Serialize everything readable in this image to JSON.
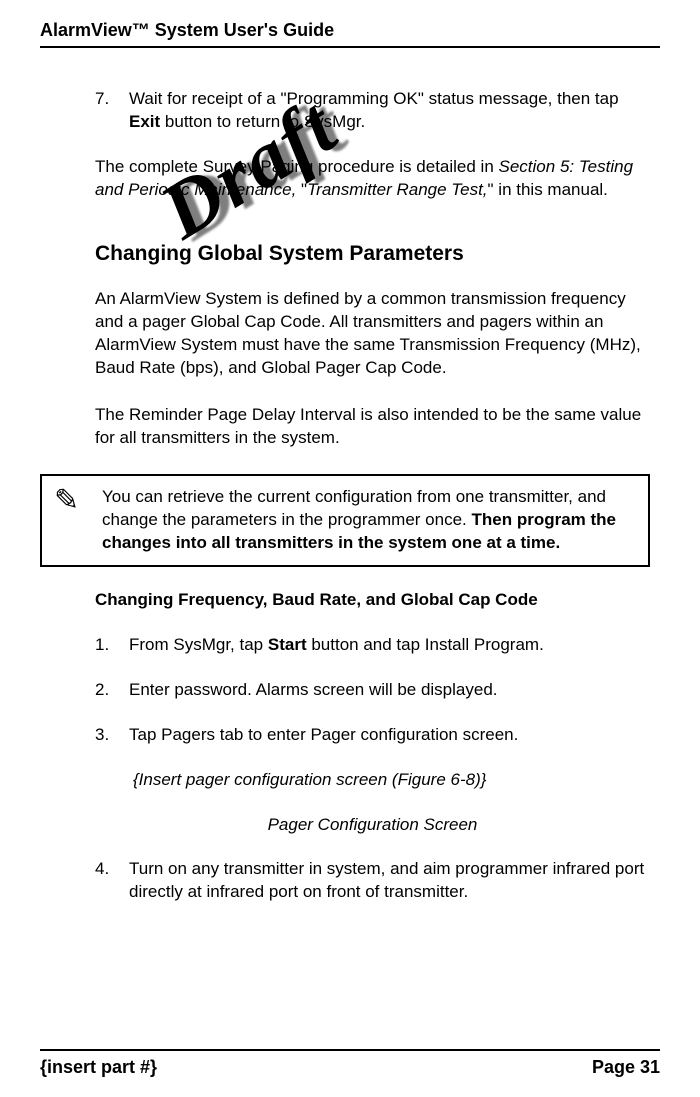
{
  "header": {
    "title": "AlarmView™ System User's Guide"
  },
  "watermark": "Draft",
  "step7": {
    "number": "7.",
    "pre": "Wait for receipt of a \"Programming OK\" status message, then tap ",
    "bold": "Exit",
    "post": " button to return to SysMgr."
  },
  "survey_para": {
    "pre": "The complete Survey Paging procedure is detailed in ",
    "ital1": "Section 5: Testing and Periodic Maintenance,",
    "mid": " \"",
    "ital2": "Transmitter Range Test,",
    "post": "\" in this manual."
  },
  "heading_global": "Changing Global System Parameters",
  "global_p1": "An AlarmView System is defined by a common transmission frequency and a pager Global Cap Code. All transmitters and pagers within an AlarmView System must have the same Transmission Frequency (MHz), Baud Rate (bps), and Global Pager Cap Code.",
  "global_p2": "The Reminder Page Delay Interval is also intended to be the same value for all transmitters in the system.",
  "note": {
    "icon": "✎",
    "lead": "You can retrieve the current configuration from one transmitter, and change the parameters in the programmer once. ",
    "bold": "Then program the changes into all transmitters in the system one at a time."
  },
  "subheading_change": "Changing Frequency, Baud Rate, and Global Cap Code",
  "steps_change": {
    "s1": {
      "num": "1.",
      "pre": "From SysMgr, tap ",
      "bold": "Start",
      "post": " button and tap Install Program."
    },
    "s2": {
      "num": "2.",
      "text": "Enter password. Alarms screen will be displayed."
    },
    "s3": {
      "num": "3.",
      "text": "Tap Pagers tab to enter Pager configuration screen."
    },
    "fig_insert": "{Insert pager configuration screen (Figure 6-8)}",
    "fig_caption": "Pager Configuration Screen",
    "s4": {
      "num": "4.",
      "text": "Turn on any transmitter in system, and aim programmer infrared port directly at infrared port on front of transmitter."
    }
  },
  "footer": {
    "left": "{insert part #}",
    "right": "Page 31"
  }
}
